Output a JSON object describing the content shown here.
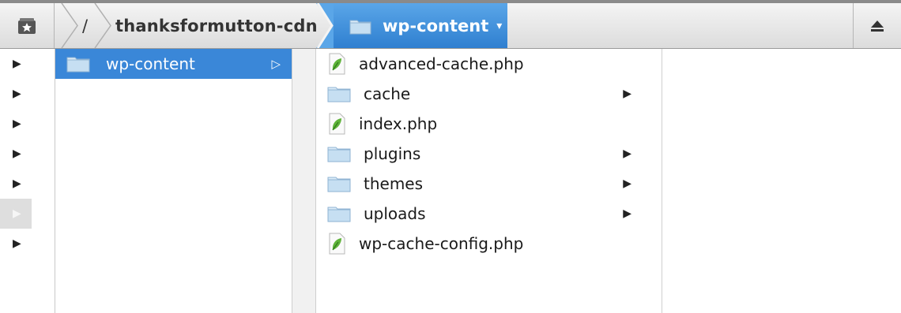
{
  "pathbar": {
    "root_label": "/",
    "host_label": "thanksformutton-cdn",
    "current_label": "wp-content",
    "favorites_icon": "star-box-icon",
    "eject_icon": "eject-icon"
  },
  "left_triangles": [
    {
      "icon": "triangle-right-icon",
      "state": "normal"
    },
    {
      "icon": "triangle-right-icon",
      "state": "normal"
    },
    {
      "icon": "triangle-right-icon",
      "state": "normal"
    },
    {
      "icon": "triangle-right-icon",
      "state": "normal"
    },
    {
      "icon": "triangle-right-icon",
      "state": "normal"
    },
    {
      "icon": "triangle-right-icon",
      "state": "dimmed"
    },
    {
      "icon": "triangle-right-icon",
      "state": "normal"
    }
  ],
  "column1": {
    "items": [
      {
        "name": "wp-content",
        "type": "folder",
        "selected": true,
        "has_children": true
      }
    ]
  },
  "column2": {
    "items": [
      {
        "name": "advanced-cache.php",
        "type": "php-file",
        "has_children": false
      },
      {
        "name": "cache",
        "type": "folder",
        "has_children": true
      },
      {
        "name": "index.php",
        "type": "php-file",
        "has_children": false
      },
      {
        "name": "plugins",
        "type": "folder",
        "has_children": true
      },
      {
        "name": "themes",
        "type": "folder",
        "has_children": true
      },
      {
        "name": "uploads",
        "type": "folder",
        "has_children": true
      },
      {
        "name": "wp-cache-config.php",
        "type": "php-file",
        "has_children": false
      }
    ]
  },
  "colors": {
    "selection": "#3a87d8",
    "path_current": "#3d8ad8",
    "folder": "#a9cbe6",
    "php_leaf": "#5fb33a"
  }
}
